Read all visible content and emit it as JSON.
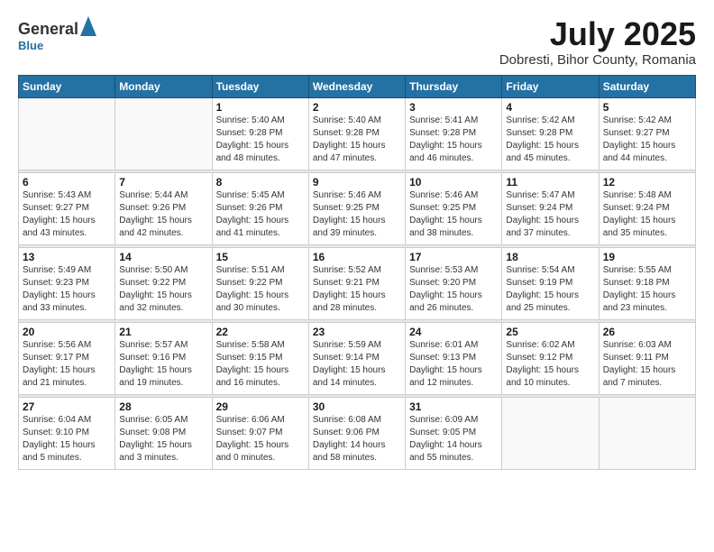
{
  "header": {
    "logo": {
      "general": "General",
      "blue": "Blue"
    },
    "title": "July 2025",
    "location": "Dobresti, Bihor County, Romania"
  },
  "calendar": {
    "days_of_week": [
      "Sunday",
      "Monday",
      "Tuesday",
      "Wednesday",
      "Thursday",
      "Friday",
      "Saturday"
    ],
    "weeks": [
      [
        {
          "day": "",
          "info": ""
        },
        {
          "day": "",
          "info": ""
        },
        {
          "day": "1",
          "info": "Sunrise: 5:40 AM\nSunset: 9:28 PM\nDaylight: 15 hours\nand 48 minutes."
        },
        {
          "day": "2",
          "info": "Sunrise: 5:40 AM\nSunset: 9:28 PM\nDaylight: 15 hours\nand 47 minutes."
        },
        {
          "day": "3",
          "info": "Sunrise: 5:41 AM\nSunset: 9:28 PM\nDaylight: 15 hours\nand 46 minutes."
        },
        {
          "day": "4",
          "info": "Sunrise: 5:42 AM\nSunset: 9:28 PM\nDaylight: 15 hours\nand 45 minutes."
        },
        {
          "day": "5",
          "info": "Sunrise: 5:42 AM\nSunset: 9:27 PM\nDaylight: 15 hours\nand 44 minutes."
        }
      ],
      [
        {
          "day": "6",
          "info": "Sunrise: 5:43 AM\nSunset: 9:27 PM\nDaylight: 15 hours\nand 43 minutes."
        },
        {
          "day": "7",
          "info": "Sunrise: 5:44 AM\nSunset: 9:26 PM\nDaylight: 15 hours\nand 42 minutes."
        },
        {
          "day": "8",
          "info": "Sunrise: 5:45 AM\nSunset: 9:26 PM\nDaylight: 15 hours\nand 41 minutes."
        },
        {
          "day": "9",
          "info": "Sunrise: 5:46 AM\nSunset: 9:25 PM\nDaylight: 15 hours\nand 39 minutes."
        },
        {
          "day": "10",
          "info": "Sunrise: 5:46 AM\nSunset: 9:25 PM\nDaylight: 15 hours\nand 38 minutes."
        },
        {
          "day": "11",
          "info": "Sunrise: 5:47 AM\nSunset: 9:24 PM\nDaylight: 15 hours\nand 37 minutes."
        },
        {
          "day": "12",
          "info": "Sunrise: 5:48 AM\nSunset: 9:24 PM\nDaylight: 15 hours\nand 35 minutes."
        }
      ],
      [
        {
          "day": "13",
          "info": "Sunrise: 5:49 AM\nSunset: 9:23 PM\nDaylight: 15 hours\nand 33 minutes."
        },
        {
          "day": "14",
          "info": "Sunrise: 5:50 AM\nSunset: 9:22 PM\nDaylight: 15 hours\nand 32 minutes."
        },
        {
          "day": "15",
          "info": "Sunrise: 5:51 AM\nSunset: 9:22 PM\nDaylight: 15 hours\nand 30 minutes."
        },
        {
          "day": "16",
          "info": "Sunrise: 5:52 AM\nSunset: 9:21 PM\nDaylight: 15 hours\nand 28 minutes."
        },
        {
          "day": "17",
          "info": "Sunrise: 5:53 AM\nSunset: 9:20 PM\nDaylight: 15 hours\nand 26 minutes."
        },
        {
          "day": "18",
          "info": "Sunrise: 5:54 AM\nSunset: 9:19 PM\nDaylight: 15 hours\nand 25 minutes."
        },
        {
          "day": "19",
          "info": "Sunrise: 5:55 AM\nSunset: 9:18 PM\nDaylight: 15 hours\nand 23 minutes."
        }
      ],
      [
        {
          "day": "20",
          "info": "Sunrise: 5:56 AM\nSunset: 9:17 PM\nDaylight: 15 hours\nand 21 minutes."
        },
        {
          "day": "21",
          "info": "Sunrise: 5:57 AM\nSunset: 9:16 PM\nDaylight: 15 hours\nand 19 minutes."
        },
        {
          "day": "22",
          "info": "Sunrise: 5:58 AM\nSunset: 9:15 PM\nDaylight: 15 hours\nand 16 minutes."
        },
        {
          "day": "23",
          "info": "Sunrise: 5:59 AM\nSunset: 9:14 PM\nDaylight: 15 hours\nand 14 minutes."
        },
        {
          "day": "24",
          "info": "Sunrise: 6:01 AM\nSunset: 9:13 PM\nDaylight: 15 hours\nand 12 minutes."
        },
        {
          "day": "25",
          "info": "Sunrise: 6:02 AM\nSunset: 9:12 PM\nDaylight: 15 hours\nand 10 minutes."
        },
        {
          "day": "26",
          "info": "Sunrise: 6:03 AM\nSunset: 9:11 PM\nDaylight: 15 hours\nand 7 minutes."
        }
      ],
      [
        {
          "day": "27",
          "info": "Sunrise: 6:04 AM\nSunset: 9:10 PM\nDaylight: 15 hours\nand 5 minutes."
        },
        {
          "day": "28",
          "info": "Sunrise: 6:05 AM\nSunset: 9:08 PM\nDaylight: 15 hours\nand 3 minutes."
        },
        {
          "day": "29",
          "info": "Sunrise: 6:06 AM\nSunset: 9:07 PM\nDaylight: 15 hours\nand 0 minutes."
        },
        {
          "day": "30",
          "info": "Sunrise: 6:08 AM\nSunset: 9:06 PM\nDaylight: 14 hours\nand 58 minutes."
        },
        {
          "day": "31",
          "info": "Sunrise: 6:09 AM\nSunset: 9:05 PM\nDaylight: 14 hours\nand 55 minutes."
        },
        {
          "day": "",
          "info": ""
        },
        {
          "day": "",
          "info": ""
        }
      ]
    ]
  }
}
